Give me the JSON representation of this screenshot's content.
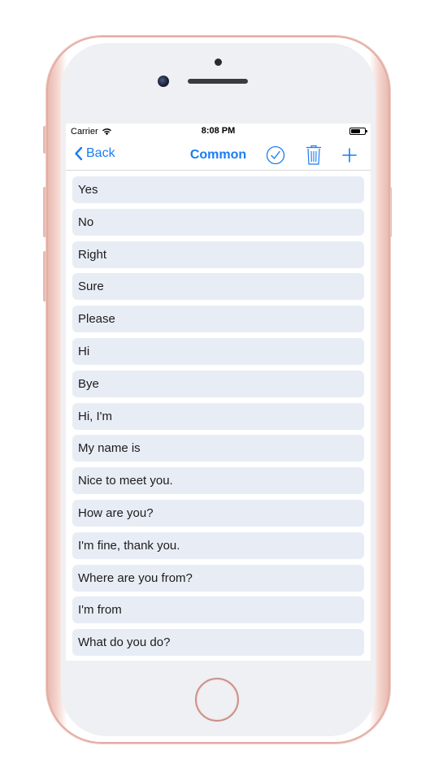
{
  "status_bar": {
    "carrier": "Carrier",
    "time": "8:08 PM",
    "battery_level": 0.7
  },
  "nav": {
    "back_label": "Back",
    "title": "Common",
    "icons": [
      "chevron-left-icon",
      "checkmark-circle-icon",
      "trash-icon",
      "plus-icon"
    ]
  },
  "phrases": [
    "Yes",
    "No",
    "Right",
    "Sure",
    "Please",
    "Hi",
    "Bye",
    "Hi, I'm",
    "My name is",
    "Nice to meet you.",
    "How are you?",
    "I'm fine, thank you.",
    "Where are you from?",
    "I'm from",
    "What do you do?"
  ],
  "colors": {
    "accent": "#1a7cf2",
    "row_background": "#e8edf5",
    "phone_body": "#f3d3cc"
  }
}
